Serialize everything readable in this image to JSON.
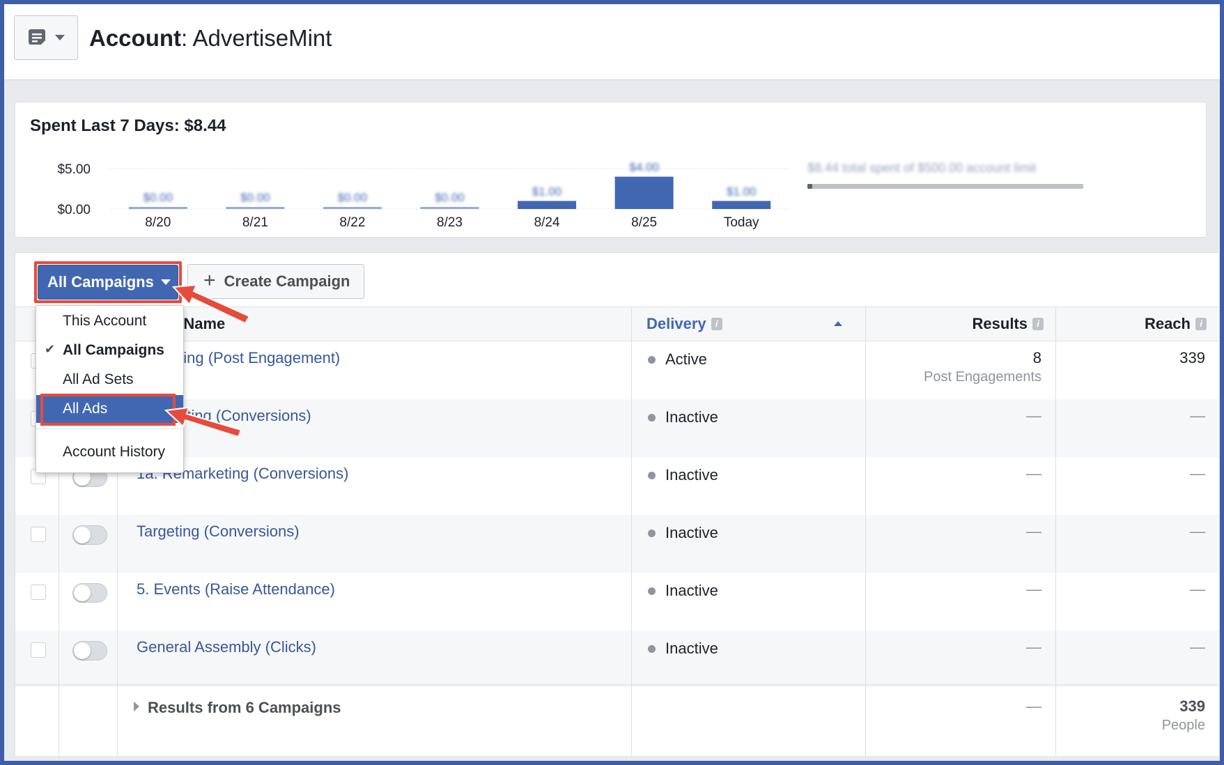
{
  "header": {
    "title_bold": "Account",
    "title_rest": ": AdvertiseMint",
    "menu_icon": "notes-icon",
    "menu_caret_icon": "caret-down-icon"
  },
  "spend": {
    "title": "Spent Last 7 Days: $8.44",
    "account_limit_text": "$8.44 total spent of $500.00 account limit",
    "account_limit_fraction": 0.017
  },
  "chart_data": {
    "type": "bar",
    "categories": [
      "8/20",
      "8/21",
      "8/22",
      "8/23",
      "8/24",
      "8/25",
      "Today"
    ],
    "values": [
      0.0,
      0.0,
      0.0,
      0.0,
      1.0,
      4.0,
      1.0
    ],
    "data_labels": [
      "$0.00",
      "$0.00",
      "$0.00",
      "$0.00",
      "$1.00",
      "$4.00",
      "$1.00"
    ],
    "y_ticks": [
      "$5.00",
      "$0.00"
    ],
    "ylim": [
      0,
      5
    ],
    "color": "#4267b2",
    "grid": true
  },
  "toolbar": {
    "all_campaigns_label": "All Campaigns",
    "create_campaign_label": "Create Campaign"
  },
  "dropdown": {
    "items": [
      "This Account",
      "All Campaigns",
      "All Ad Sets",
      "All Ads",
      "Account History"
    ],
    "selected": "All Campaigns",
    "highlighted": "All Ads"
  },
  "table": {
    "headers": {
      "name": "Campaign Name",
      "name_visible": "aign Name",
      "delivery": "Delivery",
      "results": "Results",
      "reach": "Reach"
    },
    "rows": [
      {
        "name": "marketing (Post Engagement)",
        "delivery": "Active",
        "results": "8",
        "results_sub": "Post Engagements",
        "reach": "339"
      },
      {
        "name": "eting (Conversions)",
        "delivery": "Inactive",
        "results": "—",
        "results_sub": "",
        "reach": "—"
      },
      {
        "name": "1a. Remarketing (Conversions)",
        "delivery": "Inactive",
        "results": "—",
        "results_sub": "",
        "reach": "—"
      },
      {
        "name": "Targeting (Conversions)",
        "delivery": "Inactive",
        "results": "—",
        "results_sub": "",
        "reach": "—"
      },
      {
        "name": "5. Events (Raise Attendance)",
        "delivery": "Inactive",
        "results": "—",
        "results_sub": "",
        "reach": "—"
      },
      {
        "name": "General Assembly (Clicks)",
        "delivery": "Inactive",
        "results": "—",
        "results_sub": "",
        "reach": "—"
      }
    ],
    "footer": {
      "label": "Results from 6 Campaigns",
      "results": "—",
      "reach": "339",
      "reach_sub": "People"
    }
  },
  "colors": {
    "accent": "#4267b2",
    "annotation": "#e64b3c",
    "link": "#365899"
  }
}
